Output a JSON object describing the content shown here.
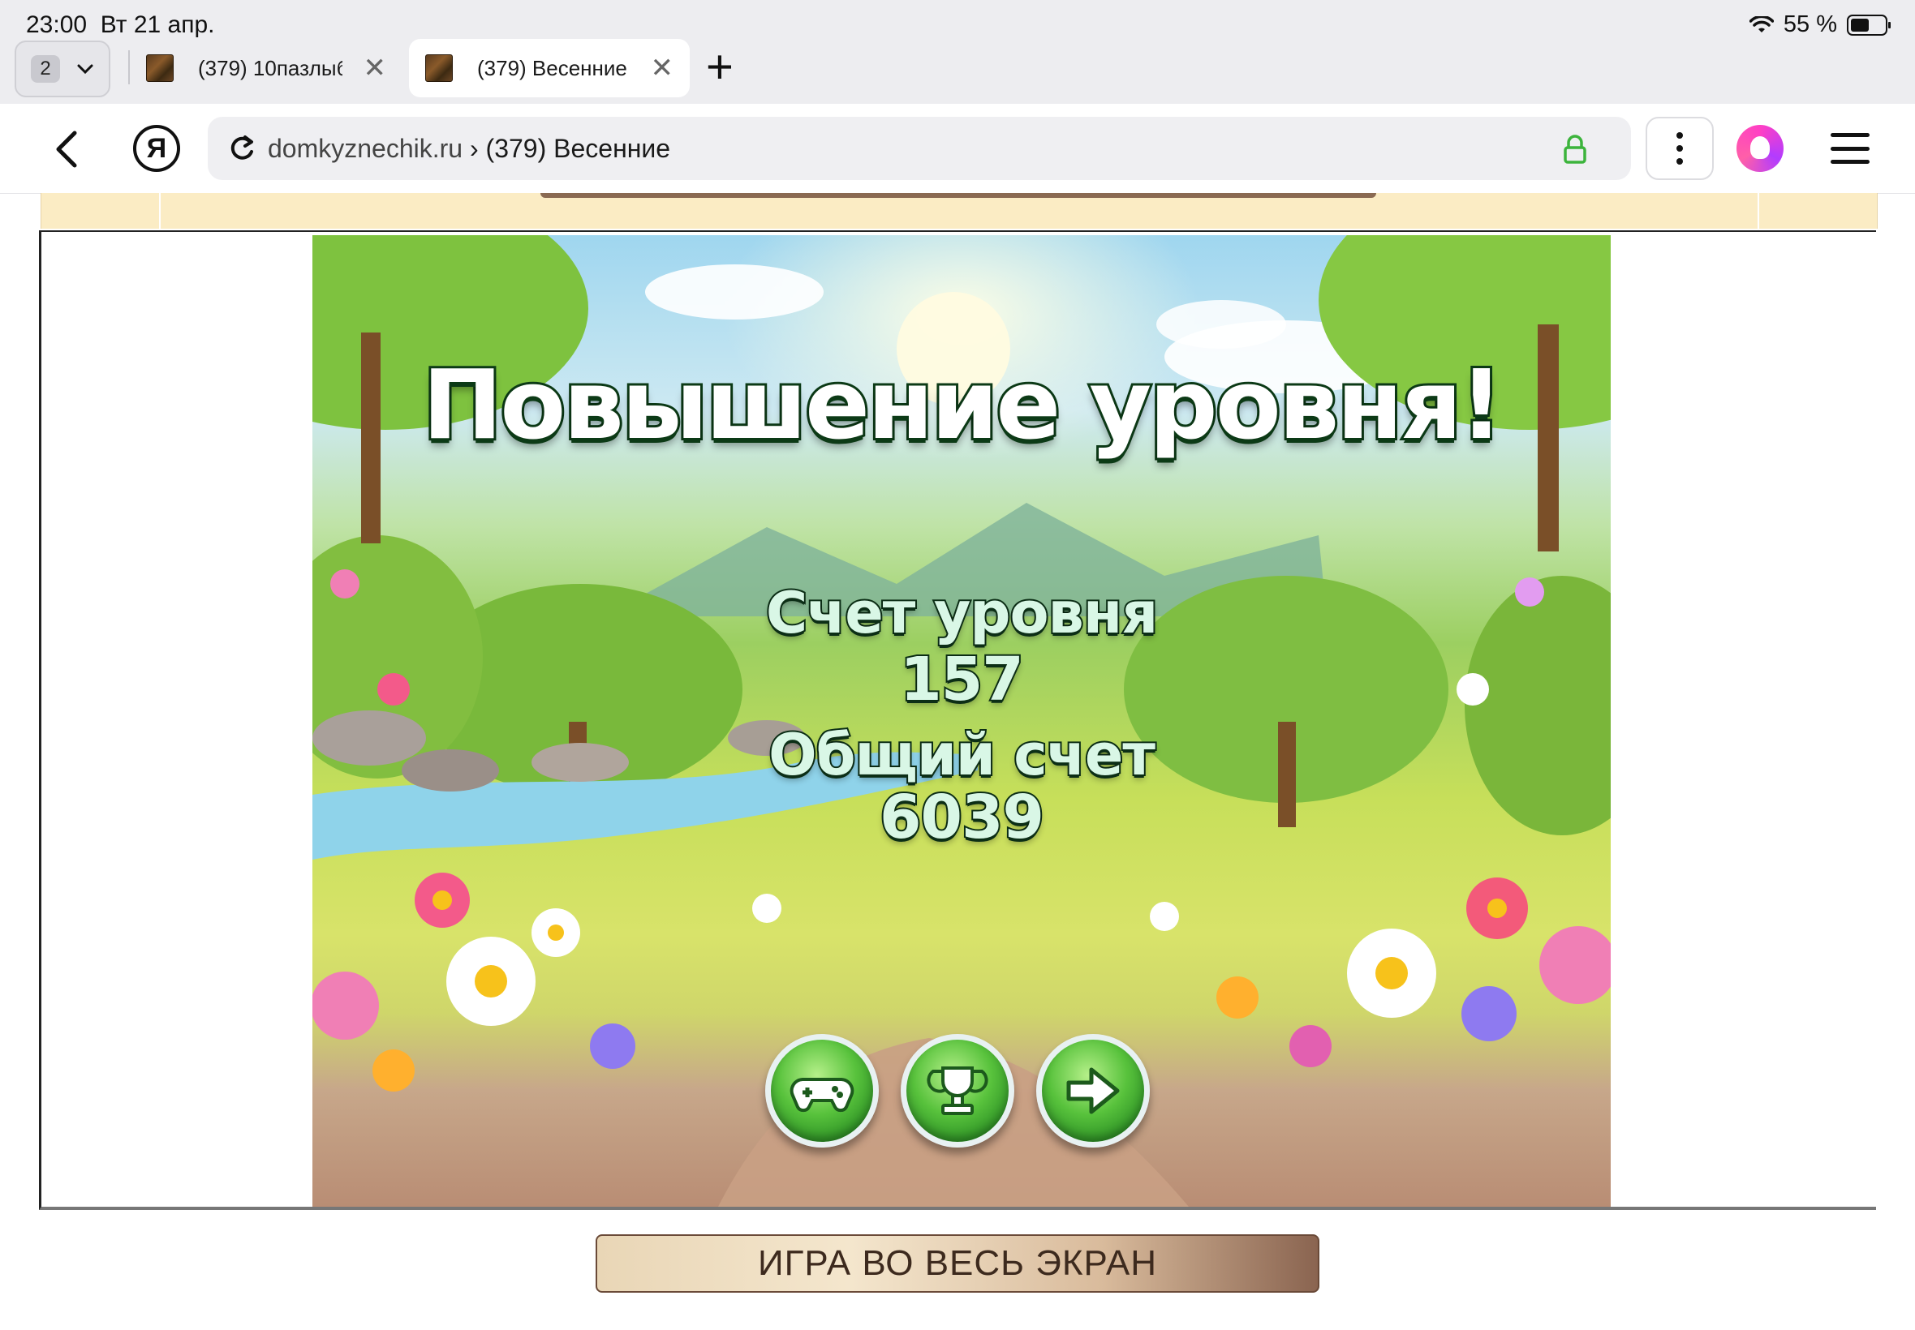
{
  "status_bar": {
    "time": "23:00",
    "date": "Вт 21 апр.",
    "battery": "55 %",
    "battery_level": 0.55
  },
  "tabs": {
    "count": "2",
    "items": [
      {
        "title": "(379) 10пазлыб",
        "active": false
      },
      {
        "title": "(379) Весенние",
        "active": true
      }
    ]
  },
  "address_bar": {
    "domain": "domkyznechik.ru",
    "separator": "›",
    "page_title": "(379) Весенние",
    "yandex_letter": "Я"
  },
  "game": {
    "headline": "Повышение уровня!",
    "level_score_label": "Счет уровня",
    "level_score": "157",
    "total_score_label": "Общий счет",
    "total_score": "6039",
    "buttons": [
      "gamepad-icon",
      "trophy-icon",
      "arrow-right-icon"
    ]
  },
  "page": {
    "fullscreen_label": "ИГРА ВО ВЕСЬ ЭКРАН"
  },
  "colors": {
    "headline_fill": "#ffffff",
    "headline_outline": "#0c3a16",
    "button_green": "#58c23c",
    "fullscreen_bg": "#e9d6b6"
  }
}
